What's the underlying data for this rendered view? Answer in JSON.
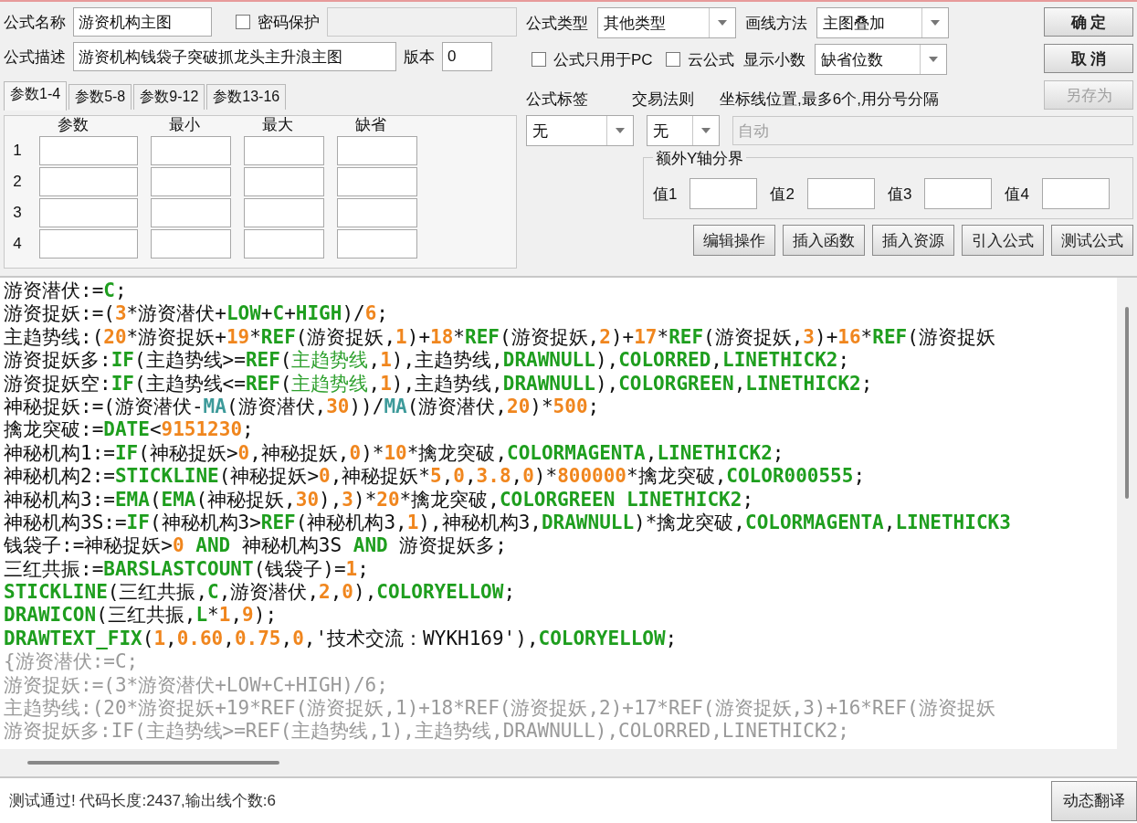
{
  "formula_name": {
    "label": "公式名称",
    "value": "游资机构主图"
  },
  "password": {
    "label": "密码保护",
    "checked": false,
    "field_disabled": true
  },
  "description": {
    "label": "公式描述",
    "value": "游资机构钱袋子突破抓龙头主升浪主图"
  },
  "version": {
    "label": "版本",
    "value": "0"
  },
  "param_tabs": [
    {
      "label": "参数1-4",
      "selected": true
    },
    {
      "label": "参数5-8",
      "selected": false
    },
    {
      "label": "参数9-12",
      "selected": false
    },
    {
      "label": "参数13-16",
      "selected": false
    }
  ],
  "param_table": {
    "columns": [
      "参数",
      "最小",
      "最大",
      "缺省"
    ],
    "rows": [
      "1",
      "2",
      "3",
      "4"
    ]
  },
  "formula_type": {
    "label": "公式类型",
    "value": "其他类型"
  },
  "draw_method": {
    "label": "画线方法",
    "value": "主图叠加"
  },
  "options": [
    {
      "label": "公式只用于PC",
      "checked": false
    },
    {
      "label": "云公式",
      "checked": false
    }
  ],
  "decimals": {
    "label": "显示小数",
    "value": "缺省位数"
  },
  "side_buttons": [
    {
      "label": "确 定",
      "disabled": false
    },
    {
      "label": "取 消",
      "disabled": false
    },
    {
      "label": "另存为",
      "disabled": true
    }
  ],
  "formula_tag": {
    "label": "公式标签",
    "value": "无"
  },
  "trade_rule": {
    "label": "交易法则",
    "value": "无"
  },
  "axis_lines": {
    "label": "坐标线位置,最多6个,用分号分隔",
    "placeholder": "自动",
    "disabled": true
  },
  "y_bounds": {
    "title": "额外Y轴分界",
    "fields": [
      "值1",
      "值2",
      "值3",
      "值4"
    ]
  },
  "action_buttons": [
    "编辑操作",
    "插入函数",
    "插入资源",
    "引入公式",
    "测试公式"
  ],
  "code_lines": [
    {
      "kind": "code",
      "tokens": [
        {
          "kind": "plain",
          "text": "游资潜伏:="
        },
        {
          "kind": "func",
          "text": "C"
        },
        {
          "kind": "plain",
          "text": ";"
        }
      ]
    },
    {
      "kind": "code",
      "tokens": [
        {
          "kind": "plain",
          "text": "游资捉妖:=("
        },
        {
          "kind": "num",
          "text": "3"
        },
        {
          "kind": "plain",
          "text": "*游资潜伏+"
        },
        {
          "kind": "func",
          "text": "LOW"
        },
        {
          "kind": "plain",
          "text": "+"
        },
        {
          "kind": "func",
          "text": "C"
        },
        {
          "kind": "plain",
          "text": "+"
        },
        {
          "kind": "func",
          "text": "HIGH"
        },
        {
          "kind": "plain",
          "text": ")/"
        },
        {
          "kind": "num",
          "text": "6"
        },
        {
          "kind": "plain",
          "text": ";"
        }
      ]
    },
    {
      "kind": "code",
      "tokens": [
        {
          "kind": "plain",
          "text": "主趋势线:("
        },
        {
          "kind": "num",
          "text": "20"
        },
        {
          "kind": "plain",
          "text": "*游资捉妖+"
        },
        {
          "kind": "num",
          "text": "19"
        },
        {
          "kind": "plain",
          "text": "*"
        },
        {
          "kind": "func",
          "text": "REF"
        },
        {
          "kind": "plain",
          "text": "(游资捉妖,"
        },
        {
          "kind": "num",
          "text": "1"
        },
        {
          "kind": "plain",
          "text": ")+"
        },
        {
          "kind": "num",
          "text": "18"
        },
        {
          "kind": "plain",
          "text": "*"
        },
        {
          "kind": "func",
          "text": "REF"
        },
        {
          "kind": "plain",
          "text": "(游资捉妖,"
        },
        {
          "kind": "num",
          "text": "2"
        },
        {
          "kind": "plain",
          "text": ")+"
        },
        {
          "kind": "num",
          "text": "17"
        },
        {
          "kind": "plain",
          "text": "*"
        },
        {
          "kind": "func",
          "text": "REF"
        },
        {
          "kind": "plain",
          "text": "(游资捉妖,"
        },
        {
          "kind": "num",
          "text": "3"
        },
        {
          "kind": "plain",
          "text": ")+"
        },
        {
          "kind": "num",
          "text": "16"
        },
        {
          "kind": "plain",
          "text": "*"
        },
        {
          "kind": "func",
          "text": "REF"
        },
        {
          "kind": "plain",
          "text": "(游资捉妖"
        }
      ]
    },
    {
      "kind": "code",
      "tokens": [
        {
          "kind": "plain",
          "text": "游资捉妖多:"
        },
        {
          "kind": "func",
          "text": "IF"
        },
        {
          "kind": "plain",
          "text": "(主趋势线>="
        },
        {
          "kind": "func",
          "text": "REF"
        },
        {
          "kind": "plain",
          "text": "("
        },
        {
          "kind": "var",
          "text": "主趋势线"
        },
        {
          "kind": "plain",
          "text": ","
        },
        {
          "kind": "num",
          "text": "1"
        },
        {
          "kind": "plain",
          "text": "),主趋势线,"
        },
        {
          "kind": "func",
          "text": "DRAWNULL"
        },
        {
          "kind": "plain",
          "text": "),"
        },
        {
          "kind": "func",
          "text": "COLORRED"
        },
        {
          "kind": "plain",
          "text": ","
        },
        {
          "kind": "func",
          "text": "LINETHICK2"
        },
        {
          "kind": "plain",
          "text": ";"
        }
      ]
    },
    {
      "kind": "code",
      "tokens": [
        {
          "kind": "plain",
          "text": "游资捉妖空:"
        },
        {
          "kind": "func",
          "text": "IF"
        },
        {
          "kind": "plain",
          "text": "(主趋势线<="
        },
        {
          "kind": "func",
          "text": "REF"
        },
        {
          "kind": "plain",
          "text": "("
        },
        {
          "kind": "var",
          "text": "主趋势线"
        },
        {
          "kind": "plain",
          "text": ","
        },
        {
          "kind": "num",
          "text": "1"
        },
        {
          "kind": "plain",
          "text": "),主趋势线,"
        },
        {
          "kind": "func",
          "text": "DRAWNULL"
        },
        {
          "kind": "plain",
          "text": "),"
        },
        {
          "kind": "func",
          "text": "COLORGREEN"
        },
        {
          "kind": "plain",
          "text": ","
        },
        {
          "kind": "func",
          "text": "LINETHICK2"
        },
        {
          "kind": "plain",
          "text": ";"
        }
      ]
    },
    {
      "kind": "code",
      "tokens": [
        {
          "kind": "plain",
          "text": "神秘捉妖:=(游资潜伏-"
        },
        {
          "kind": "builtin",
          "text": "MA"
        },
        {
          "kind": "plain",
          "text": "(游资潜伏,"
        },
        {
          "kind": "num",
          "text": "30"
        },
        {
          "kind": "plain",
          "text": "))/"
        },
        {
          "kind": "builtin",
          "text": "MA"
        },
        {
          "kind": "plain",
          "text": "(游资潜伏,"
        },
        {
          "kind": "num",
          "text": "20"
        },
        {
          "kind": "plain",
          "text": ")*"
        },
        {
          "kind": "num",
          "text": "500"
        },
        {
          "kind": "plain",
          "text": ";"
        }
      ]
    },
    {
      "kind": "code",
      "tokens": [
        {
          "kind": "plain",
          "text": "擒龙突破:="
        },
        {
          "kind": "func",
          "text": "DATE"
        },
        {
          "kind": "plain",
          "text": "<"
        },
        {
          "kind": "num",
          "text": "9151230"
        },
        {
          "kind": "plain",
          "text": ";"
        }
      ]
    },
    {
      "kind": "code",
      "tokens": [
        {
          "kind": "plain",
          "text": "神秘机构1:="
        },
        {
          "kind": "func",
          "text": "IF"
        },
        {
          "kind": "plain",
          "text": "(神秘捉妖>"
        },
        {
          "kind": "num",
          "text": "0"
        },
        {
          "kind": "plain",
          "text": ",神秘捉妖,"
        },
        {
          "kind": "num",
          "text": "0"
        },
        {
          "kind": "plain",
          "text": ")*"
        },
        {
          "kind": "num",
          "text": "10"
        },
        {
          "kind": "plain",
          "text": "*擒龙突破,"
        },
        {
          "kind": "func",
          "text": "COLORMAGENTA"
        },
        {
          "kind": "plain",
          "text": ","
        },
        {
          "kind": "func",
          "text": "LINETHICK2"
        },
        {
          "kind": "plain",
          "text": ";"
        }
      ]
    },
    {
      "kind": "code",
      "tokens": [
        {
          "kind": "plain",
          "text": "神秘机构2:="
        },
        {
          "kind": "func",
          "text": "STICKLINE"
        },
        {
          "kind": "plain",
          "text": "(神秘捉妖>"
        },
        {
          "kind": "num",
          "text": "0"
        },
        {
          "kind": "plain",
          "text": ",神秘捉妖*"
        },
        {
          "kind": "num",
          "text": "5"
        },
        {
          "kind": "plain",
          "text": ","
        },
        {
          "kind": "num",
          "text": "0"
        },
        {
          "kind": "plain",
          "text": ","
        },
        {
          "kind": "num",
          "text": "3.8"
        },
        {
          "kind": "plain",
          "text": ","
        },
        {
          "kind": "num",
          "text": "0"
        },
        {
          "kind": "plain",
          "text": ")*"
        },
        {
          "kind": "num",
          "text": "800000"
        },
        {
          "kind": "plain",
          "text": "*擒龙突破,"
        },
        {
          "kind": "func",
          "text": "COLOR000555"
        },
        {
          "kind": "plain",
          "text": ";"
        }
      ]
    },
    {
      "kind": "code",
      "tokens": [
        {
          "kind": "plain",
          "text": "神秘机构3:="
        },
        {
          "kind": "func",
          "text": "EMA"
        },
        {
          "kind": "plain",
          "text": "("
        },
        {
          "kind": "func",
          "text": "EMA"
        },
        {
          "kind": "plain",
          "text": "(神秘捉妖,"
        },
        {
          "kind": "num",
          "text": "30"
        },
        {
          "kind": "plain",
          "text": "),"
        },
        {
          "kind": "num",
          "text": "3"
        },
        {
          "kind": "plain",
          "text": ")*"
        },
        {
          "kind": "num",
          "text": "20"
        },
        {
          "kind": "plain",
          "text": "*擒龙突破,"
        },
        {
          "kind": "func",
          "text": "COLORGREEN LINETHICK2"
        },
        {
          "kind": "plain",
          "text": ";"
        }
      ]
    },
    {
      "kind": "code",
      "tokens": [
        {
          "kind": "plain",
          "text": "神秘机构3S:="
        },
        {
          "kind": "func",
          "text": "IF"
        },
        {
          "kind": "plain",
          "text": "(神秘机构3>"
        },
        {
          "kind": "func",
          "text": "REF"
        },
        {
          "kind": "plain",
          "text": "(神秘机构3,"
        },
        {
          "kind": "num",
          "text": "1"
        },
        {
          "kind": "plain",
          "text": "),神秘机构3,"
        },
        {
          "kind": "func",
          "text": "DRAWNULL"
        },
        {
          "kind": "plain",
          "text": ")*擒龙突破,"
        },
        {
          "kind": "func",
          "text": "COLORMAGENTA"
        },
        {
          "kind": "plain",
          "text": ","
        },
        {
          "kind": "func",
          "text": "LINETHICK3"
        }
      ]
    },
    {
      "kind": "code",
      "tokens": [
        {
          "kind": "plain",
          "text": "钱袋子:=神秘捉妖>"
        },
        {
          "kind": "num",
          "text": "0"
        },
        {
          "kind": "func",
          "text": " AND"
        },
        {
          "kind": "plain",
          "text": " 神秘机构3S "
        },
        {
          "kind": "func",
          "text": "AND"
        },
        {
          "kind": "plain",
          "text": " 游资捉妖多;"
        }
      ]
    },
    {
      "kind": "code",
      "tokens": [
        {
          "kind": "plain",
          "text": "三红共振:="
        },
        {
          "kind": "func",
          "text": "BARSLASTCOUNT"
        },
        {
          "kind": "plain",
          "text": "(钱袋子)="
        },
        {
          "kind": "num",
          "text": "1"
        },
        {
          "kind": "plain",
          "text": ";"
        }
      ]
    },
    {
      "kind": "code",
      "tokens": [
        {
          "kind": "func",
          "text": "STICKLINE"
        },
        {
          "kind": "plain",
          "text": "(三红共振,"
        },
        {
          "kind": "func",
          "text": "C"
        },
        {
          "kind": "plain",
          "text": ",游资潜伏,"
        },
        {
          "kind": "num",
          "text": "2"
        },
        {
          "kind": "plain",
          "text": ","
        },
        {
          "kind": "num",
          "text": "0"
        },
        {
          "kind": "plain",
          "text": "),"
        },
        {
          "kind": "func",
          "text": "COLORYELLOW"
        },
        {
          "kind": "plain",
          "text": ";"
        }
      ]
    },
    {
      "kind": "code",
      "tokens": [
        {
          "kind": "func",
          "text": "DRAWICON"
        },
        {
          "kind": "plain",
          "text": "(三红共振,"
        },
        {
          "kind": "func",
          "text": "L"
        },
        {
          "kind": "plain",
          "text": "*"
        },
        {
          "kind": "num",
          "text": "1"
        },
        {
          "kind": "plain",
          "text": ","
        },
        {
          "kind": "num",
          "text": "9"
        },
        {
          "kind": "plain",
          "text": ");"
        }
      ]
    },
    {
      "kind": "code",
      "tokens": [
        {
          "kind": "func",
          "text": "DRAWTEXT_FIX"
        },
        {
          "kind": "plain",
          "text": "("
        },
        {
          "kind": "num",
          "text": "1"
        },
        {
          "kind": "plain",
          "text": ","
        },
        {
          "kind": "num",
          "text": "0.60"
        },
        {
          "kind": "plain",
          "text": ","
        },
        {
          "kind": "num",
          "text": "0.75"
        },
        {
          "kind": "plain",
          "text": ","
        },
        {
          "kind": "num",
          "text": "0"
        },
        {
          "kind": "plain",
          "text": ",'技术交流：WYKH169'),"
        },
        {
          "kind": "func",
          "text": "COLORYELLOW"
        },
        {
          "kind": "plain",
          "text": ";"
        }
      ]
    },
    {
      "kind": "comment",
      "text": "{游资潜伏:=C;"
    },
    {
      "kind": "comment",
      "text": "游资捉妖:=(3*游资潜伏+LOW+C+HIGH)/6;"
    },
    {
      "kind": "comment",
      "text": "主趋势线:(20*游资捉妖+19*REF(游资捉妖,1)+18*REF(游资捉妖,2)+17*REF(游资捉妖,3)+16*REF(游资捉妖"
    },
    {
      "kind": "comment",
      "text": "游资捉妖多:IF(主趋势线>=REF(主趋势线,1),主趋势线,DRAWNULL),COLORRED,LINETHICK2;"
    }
  ],
  "status_bar": {
    "message": "测试通过! 代码长度:2437,输出线个数:6",
    "button": "动态翻译"
  }
}
